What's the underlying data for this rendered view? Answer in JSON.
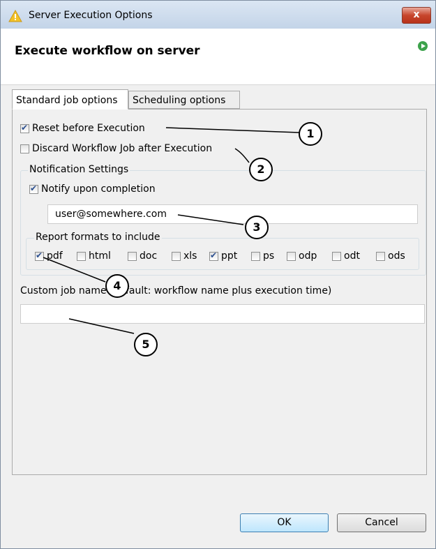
{
  "window": {
    "title": "Server Execution Options",
    "close_label": "x"
  },
  "header": {
    "title": "Execute workflow on server"
  },
  "tabs": [
    {
      "label": "Standard job options"
    },
    {
      "label": "Scheduling options"
    }
  ],
  "options": {
    "reset_before": {
      "label": "Reset before Execution",
      "checked": true
    },
    "discard_job": {
      "label": "Discard Workflow Job after Execution",
      "checked": false
    }
  },
  "notification": {
    "legend": "Notification Settings",
    "notify": {
      "label": "Notify upon completion",
      "checked": true
    },
    "email_value": "user@somewhere.com"
  },
  "report": {
    "legend": "Report formats to include",
    "formats": [
      {
        "label": "pdf",
        "checked": true
      },
      {
        "label": "html",
        "checked": false
      },
      {
        "label": "doc",
        "checked": false
      },
      {
        "label": "xls",
        "checked": false
      },
      {
        "label": "ppt",
        "checked": true
      },
      {
        "label": "ps",
        "checked": false
      },
      {
        "label": "odp",
        "checked": false
      },
      {
        "label": "odt",
        "checked": false
      },
      {
        "label": "ods",
        "checked": false
      }
    ]
  },
  "custom_job": {
    "label": "Custom job name (default: workflow name plus execution time)",
    "value": ""
  },
  "callouts": [
    "1",
    "2",
    "3",
    "4",
    "5"
  ],
  "buttons": {
    "ok": "OK",
    "cancel": "Cancel"
  },
  "colors": {
    "accent": "#3c7fb1",
    "run_icon": "#3ca24b",
    "warn_icon": "#f3c227"
  }
}
